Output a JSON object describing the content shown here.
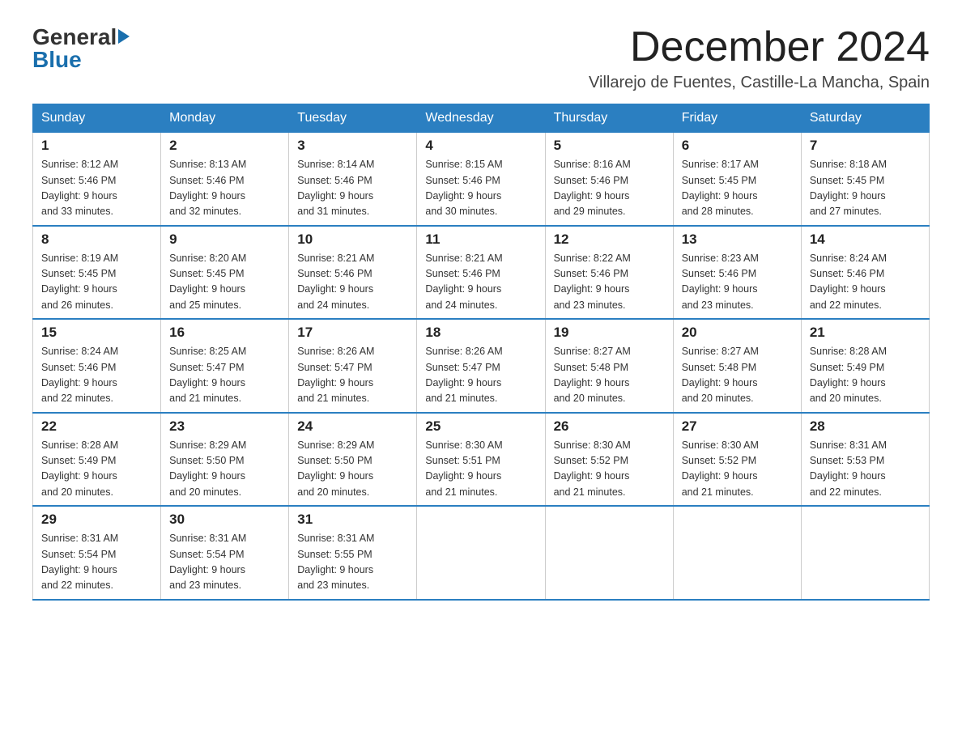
{
  "header": {
    "logo": {
      "general": "General",
      "blue": "Blue"
    },
    "title": "December 2024",
    "subtitle": "Villarejo de Fuentes, Castille-La Mancha, Spain"
  },
  "calendar": {
    "days_of_week": [
      "Sunday",
      "Monday",
      "Tuesday",
      "Wednesday",
      "Thursday",
      "Friday",
      "Saturday"
    ],
    "weeks": [
      [
        {
          "date": "1",
          "sunrise": "8:12 AM",
          "sunset": "5:46 PM",
          "daylight": "9 hours and 33 minutes."
        },
        {
          "date": "2",
          "sunrise": "8:13 AM",
          "sunset": "5:46 PM",
          "daylight": "9 hours and 32 minutes."
        },
        {
          "date": "3",
          "sunrise": "8:14 AM",
          "sunset": "5:46 PM",
          "daylight": "9 hours and 31 minutes."
        },
        {
          "date": "4",
          "sunrise": "8:15 AM",
          "sunset": "5:46 PM",
          "daylight": "9 hours and 30 minutes."
        },
        {
          "date": "5",
          "sunrise": "8:16 AM",
          "sunset": "5:46 PM",
          "daylight": "9 hours and 29 minutes."
        },
        {
          "date": "6",
          "sunrise": "8:17 AM",
          "sunset": "5:45 PM",
          "daylight": "9 hours and 28 minutes."
        },
        {
          "date": "7",
          "sunrise": "8:18 AM",
          "sunset": "5:45 PM",
          "daylight": "9 hours and 27 minutes."
        }
      ],
      [
        {
          "date": "8",
          "sunrise": "8:19 AM",
          "sunset": "5:45 PM",
          "daylight": "9 hours and 26 minutes."
        },
        {
          "date": "9",
          "sunrise": "8:20 AM",
          "sunset": "5:45 PM",
          "daylight": "9 hours and 25 minutes."
        },
        {
          "date": "10",
          "sunrise": "8:21 AM",
          "sunset": "5:46 PM",
          "daylight": "9 hours and 24 minutes."
        },
        {
          "date": "11",
          "sunrise": "8:21 AM",
          "sunset": "5:46 PM",
          "daylight": "9 hours and 24 minutes."
        },
        {
          "date": "12",
          "sunrise": "8:22 AM",
          "sunset": "5:46 PM",
          "daylight": "9 hours and 23 minutes."
        },
        {
          "date": "13",
          "sunrise": "8:23 AM",
          "sunset": "5:46 PM",
          "daylight": "9 hours and 23 minutes."
        },
        {
          "date": "14",
          "sunrise": "8:24 AM",
          "sunset": "5:46 PM",
          "daylight": "9 hours and 22 minutes."
        }
      ],
      [
        {
          "date": "15",
          "sunrise": "8:24 AM",
          "sunset": "5:46 PM",
          "daylight": "9 hours and 22 minutes."
        },
        {
          "date": "16",
          "sunrise": "8:25 AM",
          "sunset": "5:47 PM",
          "daylight": "9 hours and 21 minutes."
        },
        {
          "date": "17",
          "sunrise": "8:26 AM",
          "sunset": "5:47 PM",
          "daylight": "9 hours and 21 minutes."
        },
        {
          "date": "18",
          "sunrise": "8:26 AM",
          "sunset": "5:47 PM",
          "daylight": "9 hours and 21 minutes."
        },
        {
          "date": "19",
          "sunrise": "8:27 AM",
          "sunset": "5:48 PM",
          "daylight": "9 hours and 20 minutes."
        },
        {
          "date": "20",
          "sunrise": "8:27 AM",
          "sunset": "5:48 PM",
          "daylight": "9 hours and 20 minutes."
        },
        {
          "date": "21",
          "sunrise": "8:28 AM",
          "sunset": "5:49 PM",
          "daylight": "9 hours and 20 minutes."
        }
      ],
      [
        {
          "date": "22",
          "sunrise": "8:28 AM",
          "sunset": "5:49 PM",
          "daylight": "9 hours and 20 minutes."
        },
        {
          "date": "23",
          "sunrise": "8:29 AM",
          "sunset": "5:50 PM",
          "daylight": "9 hours and 20 minutes."
        },
        {
          "date": "24",
          "sunrise": "8:29 AM",
          "sunset": "5:50 PM",
          "daylight": "9 hours and 20 minutes."
        },
        {
          "date": "25",
          "sunrise": "8:30 AM",
          "sunset": "5:51 PM",
          "daylight": "9 hours and 21 minutes."
        },
        {
          "date": "26",
          "sunrise": "8:30 AM",
          "sunset": "5:52 PM",
          "daylight": "9 hours and 21 minutes."
        },
        {
          "date": "27",
          "sunrise": "8:30 AM",
          "sunset": "5:52 PM",
          "daylight": "9 hours and 21 minutes."
        },
        {
          "date": "28",
          "sunrise": "8:31 AM",
          "sunset": "5:53 PM",
          "daylight": "9 hours and 22 minutes."
        }
      ],
      [
        {
          "date": "29",
          "sunrise": "8:31 AM",
          "sunset": "5:54 PM",
          "daylight": "9 hours and 22 minutes."
        },
        {
          "date": "30",
          "sunrise": "8:31 AM",
          "sunset": "5:54 PM",
          "daylight": "9 hours and 23 minutes."
        },
        {
          "date": "31",
          "sunrise": "8:31 AM",
          "sunset": "5:55 PM",
          "daylight": "9 hours and 23 minutes."
        },
        null,
        null,
        null,
        null
      ]
    ],
    "labels": {
      "sunrise": "Sunrise:",
      "sunset": "Sunset:",
      "daylight": "Daylight:"
    }
  }
}
